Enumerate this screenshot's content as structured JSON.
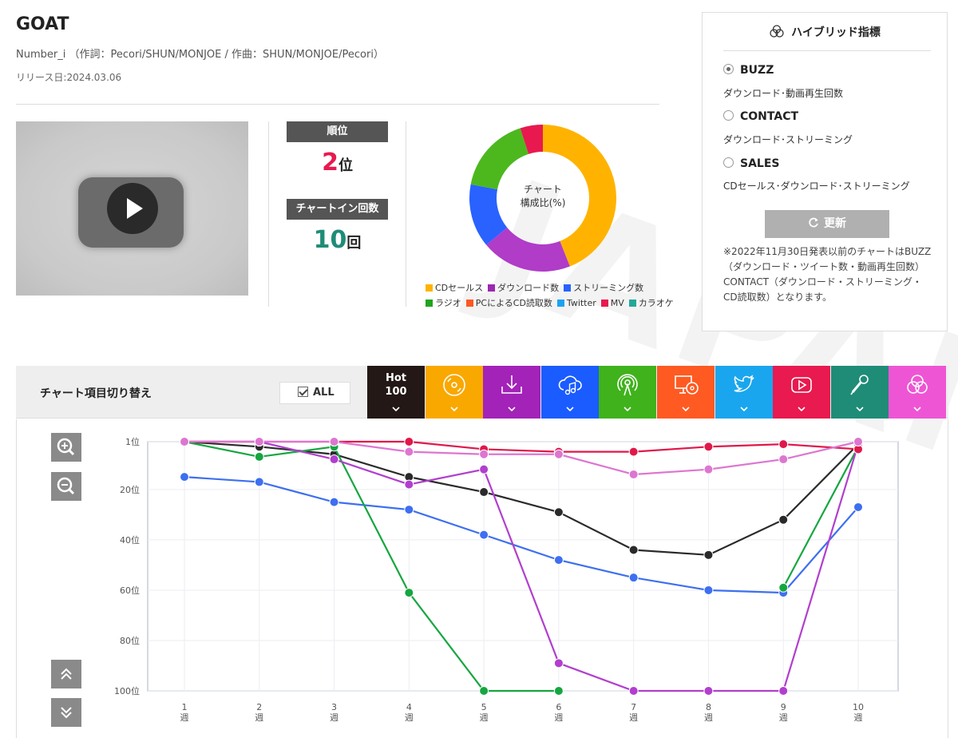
{
  "song": {
    "title": "GOAT",
    "artist_credit": "Number_i （作詞：Pecori/SHUN/MONJOE / 作曲：SHUN/MONJOE/Pecori）",
    "release": "リリース日:2024.03.06"
  },
  "stats": {
    "rank_label": "順位",
    "rank_value": "2",
    "rank_unit": "位",
    "chartin_label": "チャートイン回数",
    "chartin_value": "10",
    "chartin_unit": "回"
  },
  "donut": {
    "center_line1": "チャート",
    "center_line2": "構成比(%)",
    "segments": [
      {
        "name": "CDセールス",
        "value": 44,
        "color": "#ffb300"
      },
      {
        "name": "ダウンロード数",
        "value": 20,
        "color": "#b03cc8"
      },
      {
        "name": "ストリーミング数",
        "value": 14,
        "color": "#2962ff"
      },
      {
        "name": "ラジオ",
        "value": 17,
        "color": "#4cb81e"
      },
      {
        "name": "MV",
        "value": 5,
        "color": "#e8194f"
      }
    ],
    "legend": [
      {
        "label": "CDセールス",
        "color": "#ffb300"
      },
      {
        "label": "ダウンロード数",
        "color": "#9c27b0"
      },
      {
        "label": "ストリーミング数",
        "color": "#2962ff"
      },
      {
        "label": "ラジオ",
        "color": "#1ea51e"
      },
      {
        "label": "PCによるCD読取数",
        "color": "#ff5722"
      },
      {
        "label": "Twitter",
        "color": "#1da1f2"
      },
      {
        "label": "MV",
        "color": "#e8194f"
      },
      {
        "label": "カラオケ",
        "color": "#26a69a"
      }
    ]
  },
  "hybrid": {
    "title": "ハイブリッド指標",
    "options": [
      {
        "label": "BUZZ",
        "desc": "ダウンロード･動画再生回数",
        "selected": true
      },
      {
        "label": "CONTACT",
        "desc": "ダウンロード･ストリーミング",
        "selected": false
      },
      {
        "label": "SALES",
        "desc": "CDセールス･ダウンロード･ストリーミング",
        "selected": false
      }
    ],
    "refresh_label": "更新",
    "note": "※2022年11月30日発表以前のチャートはBUZZ（ダウンロード・ツイート数・動画再生回数）CONTACT（ダウンロード・ストリーミング・CD読取数）となります。"
  },
  "chart_toggle": {
    "title": "チャート項目切り替え",
    "all_label": "ALL",
    "hot_line1": "Hot",
    "hot_line2": "100",
    "tabs": [
      {
        "icon": "hot100-icon",
        "color": "#231815"
      },
      {
        "icon": "cd-icon",
        "color": "#f9a800"
      },
      {
        "icon": "download-icon",
        "color": "#a322b8"
      },
      {
        "icon": "streaming-icon",
        "color": "#1a5cff"
      },
      {
        "icon": "radio-icon",
        "color": "#3fb21c"
      },
      {
        "icon": "pc-cd-icon",
        "color": "#ff5a22"
      },
      {
        "icon": "twitter-icon",
        "color": "#1aa6ee"
      },
      {
        "icon": "youtube-icon",
        "color": "#e81a4f"
      },
      {
        "icon": "karaoke-icon",
        "color": "#1f8c78"
      },
      {
        "icon": "hybrid-icon",
        "color": "#ee55d4"
      }
    ]
  },
  "chart_data": {
    "type": "line",
    "x": [
      "1\n週",
      "2\n週",
      "3\n週",
      "4\n週",
      "5\n週",
      "6\n週",
      "7\n週",
      "8\n週",
      "9\n週",
      "10\n週"
    ],
    "ylim": [
      1,
      100
    ],
    "y_inverted": true,
    "yticks": [
      "1位",
      "20位",
      "40位",
      "60位",
      "80位",
      "100位"
    ],
    "ytick_values": [
      1,
      20,
      40,
      60,
      80,
      100
    ],
    "grid": true,
    "series": [
      {
        "color": "#2a2a2a",
        "values": [
          1,
          3,
          6,
          15,
          21,
          29,
          44,
          46,
          32,
          2
        ]
      },
      {
        "color": "#3d6ff0",
        "values": [
          15,
          17,
          25,
          28,
          38,
          48,
          55,
          60,
          61,
          27
        ]
      },
      {
        "color": "#16a640",
        "values": [
          1,
          7,
          3,
          61,
          100,
          100,
          null,
          null,
          59,
          3
        ]
      },
      {
        "color": "#b13fce",
        "values": [
          1,
          1,
          8,
          18,
          12,
          89,
          100,
          100,
          100,
          2
        ]
      },
      {
        "color": "#e0184a",
        "values": [
          1,
          1,
          1,
          1,
          4,
          5,
          5,
          3,
          2,
          4
        ]
      },
      {
        "color": "#dd76d0",
        "values": [
          1,
          1,
          1,
          5,
          6,
          6,
          14,
          12,
          8,
          1
        ]
      }
    ]
  }
}
